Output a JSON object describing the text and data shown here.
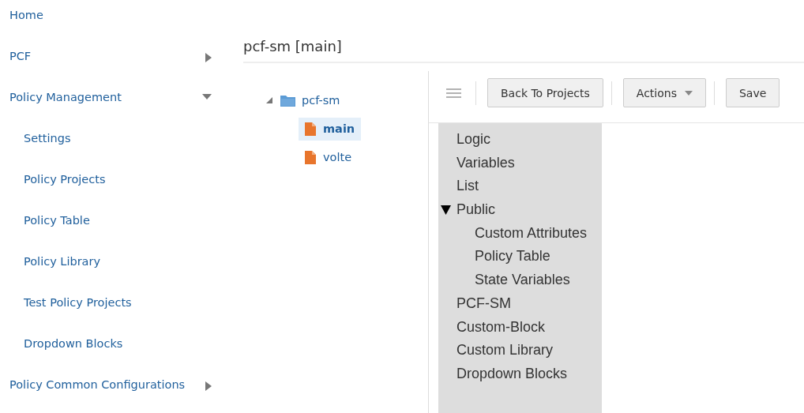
{
  "sidebar": {
    "items": [
      {
        "label": "Home"
      },
      {
        "label": "PCF",
        "expanded": false
      },
      {
        "label": "Policy Management",
        "expanded": true,
        "children": [
          {
            "label": "Settings"
          },
          {
            "label": "Policy Projects"
          },
          {
            "label": "Policy Table"
          },
          {
            "label": "Policy Library"
          },
          {
            "label": "Test Policy Projects"
          },
          {
            "label": "Dropdown Blocks"
          }
        ]
      },
      {
        "label": "Policy Common Configurations",
        "expanded": false
      }
    ]
  },
  "page_title": "pcf-sm [main]",
  "project_tree": [
    {
      "label": "pcf-sm",
      "kind": "folder",
      "expanded": true,
      "selected": false,
      "children": [
        {
          "label": "main",
          "kind": "file",
          "selected": true
        },
        {
          "label": "volte",
          "kind": "file",
          "selected": false
        }
      ]
    }
  ],
  "toolbar": {
    "buttons": [
      {
        "label": "Back To Projects",
        "kind": "plain"
      },
      {
        "label": "Actions",
        "kind": "dropdown"
      },
      {
        "label": "Save",
        "kind": "plain"
      }
    ]
  },
  "block_categories": [
    {
      "label": "Logic"
    },
    {
      "label": "Variables"
    },
    {
      "label": "List"
    },
    {
      "label": "Public",
      "expanded": true,
      "children": [
        {
          "label": "Custom Attributes"
        },
        {
          "label": "Policy Table"
        },
        {
          "label": "State Variables"
        }
      ]
    },
    {
      "label": "PCF-SM"
    },
    {
      "label": "Custom-Block"
    },
    {
      "label": "Custom Library"
    },
    {
      "label": "Dropdown Blocks"
    }
  ]
}
